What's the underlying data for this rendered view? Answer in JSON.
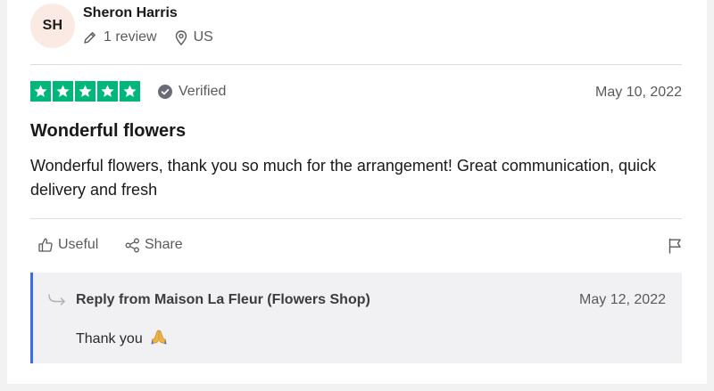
{
  "reviewer": {
    "initials": "SH",
    "name": "Sheron Harris",
    "reviews_count": "1 review",
    "country": "US"
  },
  "review": {
    "rating": 5,
    "rating_max": 5,
    "verified_label": "Verified",
    "date": "May 10, 2022",
    "title": "Wonderful flowers",
    "body": "Wonderful flowers, thank you so much for the arrangement! Great communication, quick delivery and fresh"
  },
  "actions": {
    "useful_label": "Useful",
    "share_label": "Share",
    "flag_icon": "flag-icon"
  },
  "reply": {
    "from": "Reply from Maison La Fleur (Flowers Shop)",
    "date": "May 12, 2022",
    "text": "Thank you",
    "emoji_icon": "folded-hands-emoji"
  },
  "colors": {
    "star_green": "#00b67a",
    "avatar_bg": "#fbeae3",
    "reply_accent": "#3b6ee0",
    "reply_bg": "#f1f1f4",
    "muted_text": "#5a5a5a"
  }
}
